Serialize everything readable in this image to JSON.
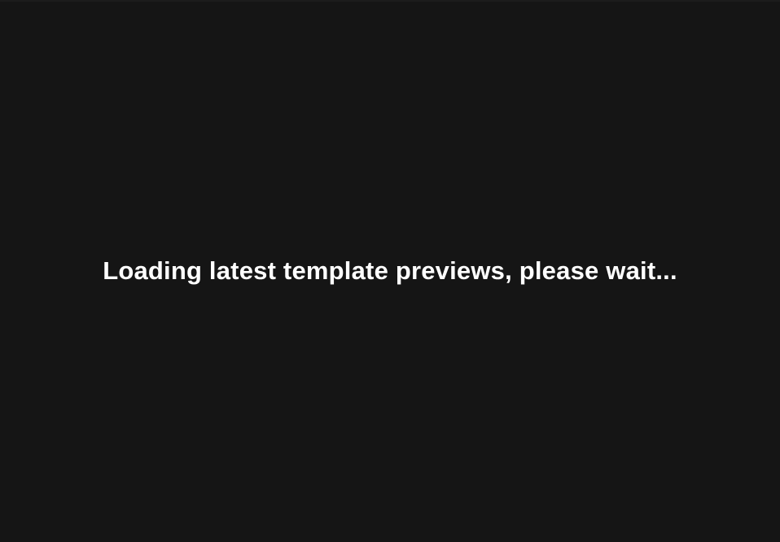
{
  "loading": {
    "message": "Loading latest template previews, please wait..."
  },
  "colors": {
    "background": "#151515",
    "text": "#ffffff"
  }
}
